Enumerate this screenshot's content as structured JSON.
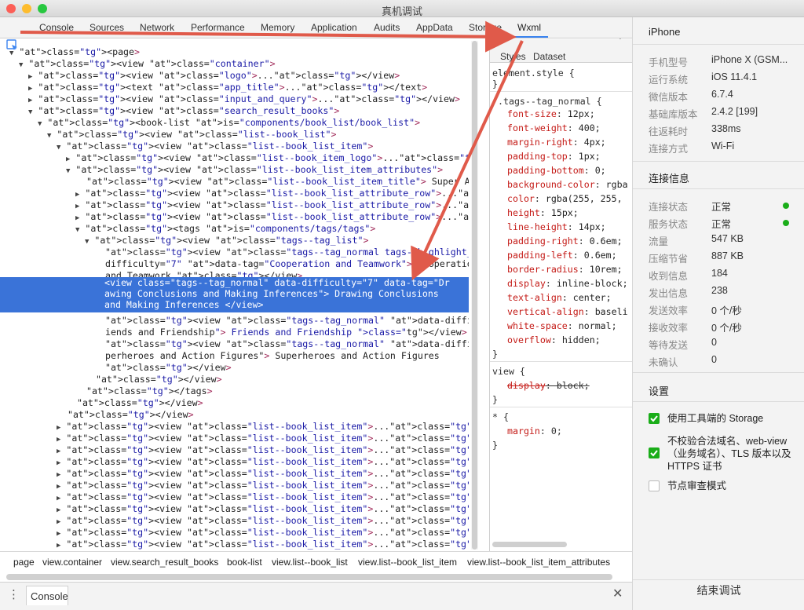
{
  "window": {
    "title": "真机调试"
  },
  "tabs": [
    "Console",
    "Sources",
    "Network",
    "Performance",
    "Memory",
    "Application",
    "Audits",
    "AppData",
    "Storage",
    "Wxml"
  ],
  "active_tab": "Wxml",
  "styles_tabs": [
    "Styles",
    "Dataset"
  ],
  "tree_lines": [
    {
      "i": 0,
      "a": "▼",
      "t": "<page>"
    },
    {
      "i": 1,
      "a": "▼",
      "t": "<view class=\"container\">"
    },
    {
      "i": 2,
      "a": "▶",
      "t": "<view class=\"logo\">...</view>"
    },
    {
      "i": 2,
      "a": "▶",
      "t": "<text class=\"app_title\">...</text>"
    },
    {
      "i": 2,
      "a": "▶",
      "t": "<view class=\"input_and_query\">...</view>"
    },
    {
      "i": 2,
      "a": "▼",
      "t": "<view class=\"search_result_books\">"
    },
    {
      "i": 3,
      "a": "▼",
      "t": "<book-list is=\"components/book_list/book_list\">"
    },
    {
      "i": 4,
      "a": "▼",
      "t": "<view class=\"list--book_list\">"
    },
    {
      "i": 5,
      "a": "▼",
      "t": "<view class=\"list--book_list_item\">"
    },
    {
      "i": 6,
      "a": "▶",
      "t": "<view class=\"list--book_item_logo\">...</view>"
    },
    {
      "i": 6,
      "a": "▼",
      "t": "<view class=\"list--book_list_item_attributes\">"
    },
    {
      "i": 7,
      "a": "",
      "t": "<view class=\"list--book_list_item_title\"> Super Amos </view>"
    },
    {
      "i": 7,
      "a": "▶",
      "t": "<view class=\"list--book_list_attribute_row\">...</view>"
    },
    {
      "i": 7,
      "a": "▶",
      "t": "<view class=\"list--book_list_attribute_row\">...</view>"
    },
    {
      "i": 7,
      "a": "▶",
      "t": "<view class=\"list--book_list_attribute_row\">...</view>"
    },
    {
      "i": 7,
      "a": "▼",
      "t": "<tags is=\"components/tags/tags\">"
    },
    {
      "i": 8,
      "a": "▼",
      "t": "<view class=\"tags--tag_list\">"
    },
    {
      "i": 9,
      "a": "",
      "t": "<view class=\"tags--tag_normal tags--highlight_tag\" data-"
    },
    {
      "i": 9,
      "a": "",
      "t": "difficulty=\"7\" data-tag=\"Cooperation and Teamwork\"> Cooperation"
    },
    {
      "i": 9,
      "a": "",
      "t": "and Teamwork </view>"
    }
  ],
  "selected_lines": [
    "<view class=\"tags--tag_normal\" data-difficulty=\"7\" data-tag=\"Dr",
    "awing Conclusions and Making Inferences\"> Drawing Conclusions",
    "and Making Inferences </view>"
  ],
  "tree_lines_after": [
    {
      "i": 9,
      "a": "",
      "t": "<view class=\"tags--tag_normal\" data-difficulty=\"7\" data-tag=\"Fr"
    },
    {
      "i": 9,
      "a": "",
      "t": "iends and Friendship\"> Friends and Friendship </view>"
    },
    {
      "i": 9,
      "a": "",
      "t": "<view class=\"tags--tag_normal\" data-difficulty=\"7\" data-tag=\"Su"
    },
    {
      "i": 9,
      "a": "",
      "t": "perheroes and Action Figures\"> Superheroes and Action Figures"
    },
    {
      "i": 9,
      "a": "",
      "t": "</view>"
    },
    {
      "i": 8,
      "a": "",
      "t": "</view>"
    },
    {
      "i": 7,
      "a": "",
      "t": "</tags>"
    },
    {
      "i": 6,
      "a": "",
      "t": "</view>"
    },
    {
      "i": 5,
      "a": "",
      "t": "</view>"
    },
    {
      "i": 5,
      "a": "▶",
      "t": "<view class=\"list--book_list_item\">...</view>"
    },
    {
      "i": 5,
      "a": "▶",
      "t": "<view class=\"list--book_list_item\">...</view>"
    },
    {
      "i": 5,
      "a": "▶",
      "t": "<view class=\"list--book_list_item\">...</view>"
    },
    {
      "i": 5,
      "a": "▶",
      "t": "<view class=\"list--book_list_item\">...</view>"
    },
    {
      "i": 5,
      "a": "▶",
      "t": "<view class=\"list--book_list_item\">...</view>"
    },
    {
      "i": 5,
      "a": "▶",
      "t": "<view class=\"list--book_list_item\">...</view>"
    },
    {
      "i": 5,
      "a": "▶",
      "t": "<view class=\"list--book_list_item\">...</view>"
    },
    {
      "i": 5,
      "a": "▶",
      "t": "<view class=\"list--book_list_item\">...</view>"
    },
    {
      "i": 5,
      "a": "▶",
      "t": "<view class=\"list--book_list_item\">...</view>"
    },
    {
      "i": 5,
      "a": "▶",
      "t": "<view class=\"list--book_list_item\">...</view>"
    },
    {
      "i": 5,
      "a": "▶",
      "t": "<view class=\"list--book_list_item\">...</view>"
    },
    {
      "i": 5,
      "a": "▶",
      "t": "<view class=\"list--book_list_item\">...</view>"
    },
    {
      "i": 5,
      "a": "▶",
      "t": "<view class=\"list--book_list_item\">...</view>"
    }
  ],
  "styles": {
    "element_style": [
      "element.style {",
      "}"
    ],
    "rule1_selector": ".tags--tag_normal {",
    "rule1_props": [
      [
        "font-size",
        "12px;"
      ],
      [
        "font-weight",
        "400;"
      ],
      [
        "margin-right",
        "4px;"
      ],
      [
        "padding-top",
        "1px;"
      ],
      [
        "padding-bottom",
        "0;"
      ],
      [
        "background-color",
        "rgba"
      ],
      [
        "color",
        "rgba(255, 255,"
      ],
      [
        "height",
        "15px;"
      ],
      [
        "line-height",
        "14px;"
      ],
      [
        "padding-right",
        "0.6em;"
      ],
      [
        "padding-left",
        "0.6em;"
      ],
      [
        "border-radius",
        "10rem;"
      ],
      [
        "display",
        "inline-block;"
      ],
      [
        "text-align",
        "center;"
      ],
      [
        "vertical-align",
        "baseli"
      ],
      [
        "white-space",
        "normal;"
      ],
      [
        "overflow",
        "hidden;"
      ]
    ],
    "rule2_selector": "view {",
    "rule2_prop": [
      "display",
      "block;"
    ],
    "rule3_selector": "* {",
    "rule3_prop": [
      "margin",
      "0;"
    ],
    "close": "}"
  },
  "breadcrumb": [
    "page",
    "view.container",
    "view.search_result_books",
    "book-list",
    "view.list--book_list",
    "view.list--book_list_item",
    "view.list--book_list_item_attributes"
  ],
  "console": {
    "label": "Console"
  },
  "panel": {
    "device_header": "iPhone",
    "device_info": [
      {
        "k": "手机型号",
        "v": "iPhone X (GSM..."
      },
      {
        "k": "运行系统",
        "v": "iOS 11.4.1"
      },
      {
        "k": "微信版本",
        "v": "6.7.4"
      },
      {
        "k": "基础库版本",
        "v": "2.4.2 [199]"
      },
      {
        "k": "往返耗时",
        "v": "338ms"
      },
      {
        "k": "连接方式",
        "v": "Wi-Fi"
      }
    ],
    "conn_header": "连接信息",
    "conn_info": [
      {
        "k": "连接状态",
        "v": "正常"
      },
      {
        "k": "服务状态",
        "v": "正常"
      },
      {
        "k": "流量",
        "v": "547 KB"
      },
      {
        "k": "压缩节省",
        "v": "887 KB"
      },
      {
        "k": "收到信息",
        "v": "184"
      },
      {
        "k": "发出信息",
        "v": "238"
      },
      {
        "k": "发送效率",
        "v": "0 个/秒"
      },
      {
        "k": "接收效率",
        "v": "0 个/秒"
      },
      {
        "k": "等待发送",
        "v": "0"
      },
      {
        "k": "未确认",
        "v": "0"
      }
    ],
    "settings_header": "设置",
    "settings": [
      {
        "label": "使用工具端的 Storage",
        "checked": true
      },
      {
        "label": "不校验合法域名、web-view（业务域名）、TLS 版本以及 HTTPS 证书",
        "checked": true
      },
      {
        "label": "节点审查模式",
        "checked": false
      }
    ],
    "end_button": "结束调试"
  },
  "colors": {
    "accent": "#3b84f0",
    "selected": "#3a73d8",
    "ok": "#1aad19",
    "annotation": "#e05a4a"
  }
}
